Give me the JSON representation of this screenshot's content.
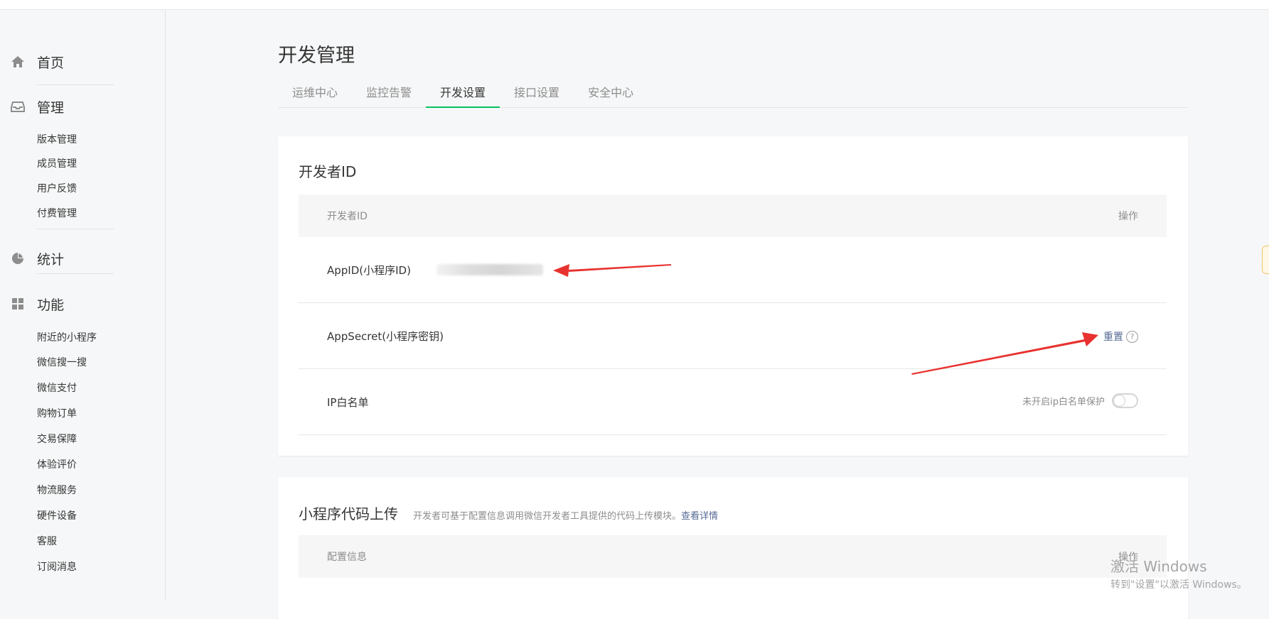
{
  "sidebar": {
    "home": "首页",
    "manage": "管理",
    "manage_items": [
      "版本管理",
      "成员管理",
      "用户反馈",
      "付费管理"
    ],
    "stats": "统计",
    "features": "功能",
    "feature_items": [
      "附近的小程序",
      "微信搜一搜",
      "微信支付",
      "购物订单",
      "交易保障",
      "体验评价",
      "物流服务",
      "硬件设备",
      "客服",
      "订阅消息"
    ]
  },
  "page": {
    "title": "开发管理",
    "tabs": [
      "运维中心",
      "监控告警",
      "开发设置",
      "接口设置",
      "安全中心"
    ],
    "active_tab": "开发设置"
  },
  "dev_id_card": {
    "title": "开发者ID",
    "col_left": "开发者ID",
    "col_right": "操作",
    "appid_label": "AppID(小程序ID)",
    "appsecret_label": "AppSecret(小程序密钥)",
    "reset_link": "重置",
    "help_glyph": "?",
    "ip_label": "IP白名单",
    "ip_status": "未开启ip白名单保护",
    "ip_enabled": false
  },
  "upload_card": {
    "title": "小程序代码上传",
    "desc": "开发者可基于配置信息调用微信开发者工具提供的代码上传模块。",
    "desc_link": "查看详情",
    "col_left": "配置信息",
    "col_right": "操作"
  },
  "watermark": {
    "line1": "激活 Windows",
    "line2": "转到\"设置\"以激活 Windows。"
  },
  "colors": {
    "accent_green": "#07c160",
    "link_blue": "#576b95",
    "arrow_red": "#e8322f"
  }
}
